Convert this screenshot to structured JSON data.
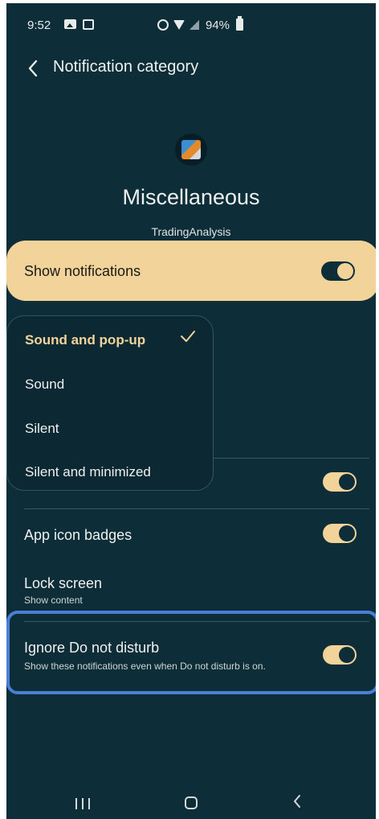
{
  "status_bar": {
    "time": "9:52",
    "battery": "94%"
  },
  "header": {
    "title": "Notification category"
  },
  "category": {
    "title": "Miscellaneous",
    "app_name": "TradingAnalysis"
  },
  "show_notifications": {
    "label": "Show notifications",
    "enabled": true
  },
  "alert_popup": {
    "options": [
      {
        "label": "Sound and pop-up",
        "selected": true
      },
      {
        "label": "Sound",
        "selected": false
      },
      {
        "label": "Silent",
        "selected": false
      },
      {
        "label": "Silent and minimized",
        "selected": false
      }
    ]
  },
  "settings": {
    "app_icon_badges": {
      "label": "App icon badges",
      "enabled": true
    },
    "lock_screen": {
      "label": "Lock screen",
      "sub": "Show content"
    },
    "ignore_dnd": {
      "label": "Ignore Do not disturb",
      "sub": "Show these notifications even when Do not disturb is on.",
      "enabled": true
    }
  },
  "colors": {
    "background": "#0d2d38",
    "accent": "#f2d39a",
    "highlight": "#4a7fd6"
  }
}
